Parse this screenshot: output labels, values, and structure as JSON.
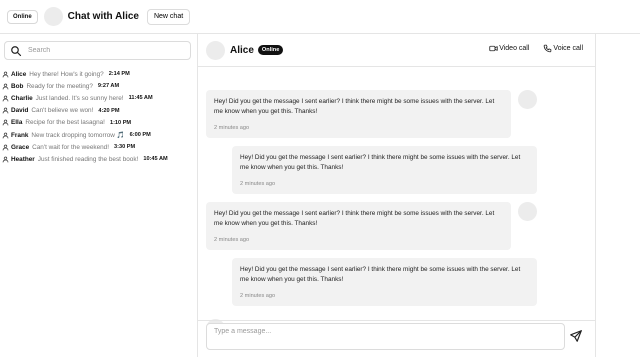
{
  "topbar": {
    "status": "Online",
    "title": "Chat with Alice",
    "new_chat_label": "New chat"
  },
  "sidebar": {
    "search_placeholder": "Search",
    "conversations": [
      {
        "name": "Alice",
        "preview": "Hey there! How's it going?",
        "time": "2:14 PM"
      },
      {
        "name": "Bob",
        "preview": "Ready for the meeting?",
        "time": "9:27 AM"
      },
      {
        "name": "Charlie",
        "preview": "Just landed. It's so sunny here!",
        "time": "11:45 AM"
      },
      {
        "name": "David",
        "preview": "Can't believe we won!",
        "time": "4:20 PM"
      },
      {
        "name": "Ella",
        "preview": "Recipe for the best lasagna!",
        "time": "1:10 PM"
      },
      {
        "name": "Frank",
        "preview": "New track dropping tomorrow 🎵",
        "time": "6:00 PM"
      },
      {
        "name": "Grace",
        "preview": "Can't wait for the weekend!",
        "time": "3:30 PM"
      },
      {
        "name": "Heather",
        "preview": "Just finished reading the best book!",
        "time": "10:45 AM"
      }
    ]
  },
  "chat": {
    "contact_name": "Alice",
    "status_badge": "Online",
    "video_call_label": "Video call",
    "voice_call_label": "Voice call",
    "messages": [
      {
        "direction": "incoming",
        "text": "Hey! Did you get the message I sent earlier? I think there might be some issues with the server. Let me know when you get this. Thanks!",
        "time": "2 minutes ago"
      },
      {
        "direction": "outgoing",
        "text": "Hey! Did you get the message I sent earlier? I think there might be some issues with the server. Let me know when you get this. Thanks!",
        "time": "2 minutes ago"
      },
      {
        "direction": "incoming",
        "text": "Hey! Did you get the message I sent earlier? I think there might be some issues with the server. Let me know when you get this. Thanks!",
        "time": "2 minutes ago"
      },
      {
        "direction": "outgoing",
        "text": "Hey! Did you get the message I sent earlier? I think there might be some issues with the server. Let me know when you get this. Thanks!",
        "time": "2 minutes ago"
      }
    ],
    "composer_placeholder": "Type a message..."
  }
}
